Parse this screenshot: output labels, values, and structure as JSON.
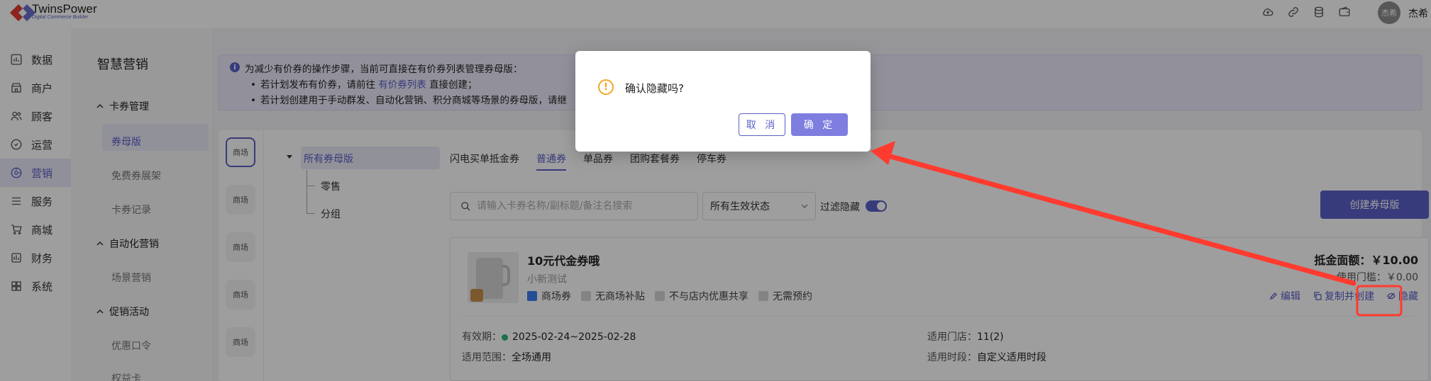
{
  "brand": {
    "name": "TwinsPower",
    "sub": "Digital Commerce Builder"
  },
  "header": {
    "icons": [
      "cloud-icon",
      "link-icon",
      "database-icon",
      "wallet-icon"
    ],
    "avatar_text": "杰希",
    "user_name": "杰希"
  },
  "nav": {
    "items": [
      {
        "label": "数据",
        "icon": "chart-icon"
      },
      {
        "label": "商户",
        "icon": "store-icon"
      },
      {
        "label": "顾客",
        "icon": "users-icon"
      },
      {
        "label": "运营",
        "icon": "target-icon"
      },
      {
        "label": "营销",
        "icon": "marketing-icon"
      },
      {
        "label": "服务",
        "icon": "list-icon"
      },
      {
        "label": "商城",
        "icon": "cart-icon"
      },
      {
        "label": "财务",
        "icon": "finance-icon"
      },
      {
        "label": "系统",
        "icon": "grid-icon"
      }
    ],
    "active_index": 4
  },
  "submenu": {
    "title": "智慧营销",
    "groups": [
      {
        "label": "卡券管理",
        "items": [
          "券母版",
          "免费券展架",
          "卡券记录"
        ]
      },
      {
        "label": "自动化营销",
        "items": [
          "场景营销"
        ]
      },
      {
        "label": "促销活动",
        "items": [
          "优惠口令",
          "权益卡"
        ]
      }
    ]
  },
  "notice": {
    "line1": "为减少有价券的操作步骤，当前可直接在有价券列表管理券母版：",
    "line2_prefix": "若计划发布有价券，请前往",
    "line2_link": "有价券列表",
    "line2_suffix": "直接创建；",
    "line3": "若计划创建用于手动群发、自动化营销、积分商城等场景的券母版，请继"
  },
  "stores": {
    "label": "商场"
  },
  "tree": {
    "root": "所有券母版",
    "children": [
      "零售",
      "分组"
    ]
  },
  "tabs": [
    "闪电买单抵金券",
    "普通券",
    "单品券",
    "团购套餐券",
    "停车券"
  ],
  "filters": {
    "search_placeholder": "请输入卡券名称/副标题/备注名搜索",
    "status_select": "所有生效状态",
    "hide_label": "过滤隐藏",
    "hide_enabled": true,
    "create_button": "创建券母版"
  },
  "coupon": {
    "title": "10元代金券哦",
    "subtitle": "小新测试",
    "tags": [
      "商场券",
      "无商场补贴",
      "不与店内优惠共享",
      "无需预约"
    ],
    "amount": "抵金面额：￥10.00",
    "threshold": "使用门槛：￥0.00",
    "actions": {
      "edit": "编辑",
      "copy": "复制并创建",
      "hide": "隐藏"
    },
    "validity_label": "有效期：",
    "validity_value": "2025-02-24~2025-02-28",
    "scope_label": "适用范围：",
    "scope_value": "全场通用",
    "stores_label": "适用门店：",
    "stores_value": "11(2)",
    "period_label": "适用时段：",
    "period_value": "自定义适用时段"
  },
  "dialog": {
    "message": "确认隐藏吗?",
    "cancel": "取 消",
    "confirm": "确 定"
  },
  "colors": {
    "accent": "#5b5fc7",
    "warning": "#f5a623",
    "annotation": "#ff3b2f"
  }
}
